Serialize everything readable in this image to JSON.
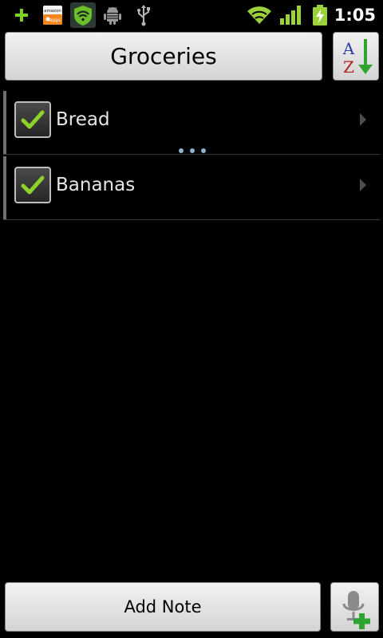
{
  "status_bar": {
    "time": "1:05",
    "notification_icons": [
      "plus-icon",
      "amazon-appstore-icon",
      "shield-icon",
      "android-debug-icon",
      "usb-icon"
    ],
    "system_icons": [
      "wifi-icon",
      "signal-icon",
      "battery-charging-icon"
    ],
    "amazon_badge_text": "amazon",
    "amazon_badge_subtext": "apps"
  },
  "header": {
    "title": "Groceries",
    "sort_icon": "sort-az-icon",
    "sort_letter_top": "A",
    "sort_letter_bottom": "Z"
  },
  "list": {
    "items": [
      {
        "label": "Bread",
        "checked": true
      },
      {
        "label": "Bananas",
        "checked": true
      }
    ]
  },
  "footer": {
    "add_note_label": "Add Note",
    "voice_icon": "microphone-add-icon"
  },
  "colors": {
    "background": "#000000",
    "check_green": "#8bd22a",
    "accent_green": "#2fa32f",
    "button_face": "#e3e3e3",
    "item_text": "#e6e6e6",
    "status_green": "#9bd13b"
  }
}
